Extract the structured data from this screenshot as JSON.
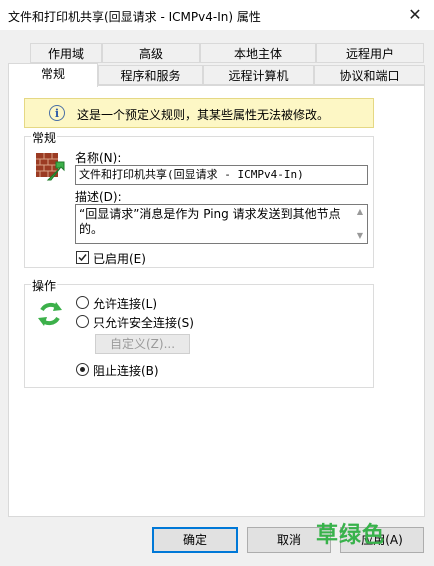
{
  "window": {
    "title": "文件和打印机共享(回显请求 - ICMPv4-In) 属性",
    "close_glyph": "✕"
  },
  "tabs": {
    "row1": [
      {
        "label": "作用域"
      },
      {
        "label": "高级"
      },
      {
        "label": "本地主体"
      },
      {
        "label": "远程用户"
      }
    ],
    "row2": [
      {
        "label": "常规",
        "selected": true
      },
      {
        "label": "程序和服务"
      },
      {
        "label": "远程计算机"
      },
      {
        "label": "协议和端口"
      }
    ]
  },
  "info_bar": {
    "icon": "info-icon",
    "text": "这是一个预定义规则，其某些属性无法被修改。"
  },
  "general_group": {
    "label": "常规",
    "icon": "firewall-rule-icon",
    "name_label": "名称(N):",
    "name_value": "文件和打印机共享(回显请求 - ICMPv4-In)",
    "description_label": "描述(D):",
    "description_value": "“回显请求”消息是作为 Ping 请求发送到其他节点的。",
    "enabled_label": "已启用(E)",
    "enabled_checked": true
  },
  "action_group": {
    "label": "操作",
    "icon": "refresh-arrows-icon",
    "options": [
      {
        "label": "允许连接(L)",
        "selected": false
      },
      {
        "label": "只允许安全连接(S)",
        "selected": false
      },
      {
        "label": "阻止连接(B)",
        "selected": true
      }
    ],
    "customize_label": "自定义(Z)..."
  },
  "buttons": {
    "ok": "确定",
    "cancel": "取消",
    "apply": "应用(A)"
  },
  "watermark": "草绿色",
  "colors": {
    "accent": "#0078d7",
    "info_bg": "#fdf7c5",
    "watermark": "#38b24b"
  }
}
